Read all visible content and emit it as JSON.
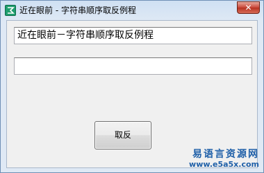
{
  "window": {
    "title": "近在眼前 - 字符串顺序取反例程",
    "close_label": "✕"
  },
  "form": {
    "input1_value": "近在眼前－字符串顺序取反例程",
    "input2_value": "",
    "button_label": "取反"
  },
  "watermark": {
    "site_name": "易语言资源网",
    "site_url": "www.e5a5x.com"
  }
}
